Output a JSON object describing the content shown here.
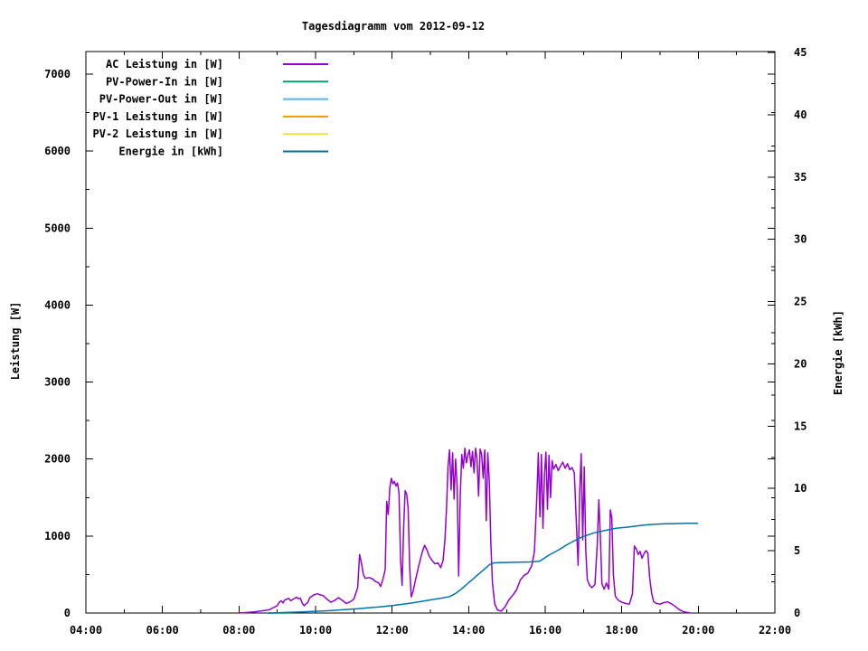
{
  "title": "Tagesdiagramm vom 2012-09-12",
  "axes": {
    "y1_label": "Leistung [W]",
    "y2_label": "Energie [kWh]"
  },
  "legend": [
    {
      "label": "AC Leistung in [W]",
      "color": "#9400d3"
    },
    {
      "label": "PV-Power-In in [W]",
      "color": "#009e73"
    },
    {
      "label": "PV-Power-Out in [W]",
      "color": "#56b4e9"
    },
    {
      "label": "PV-1 Leistung in [W]",
      "color": "#e69f00"
    },
    {
      "label": "PV-2 Leistung in [W]",
      "color": "#f0e442"
    },
    {
      "label": "Energie in [kWh]",
      "color": "#0072b2"
    }
  ],
  "chart_data": {
    "type": "line",
    "title": "Tagesdiagramm vom 2012-09-12",
    "grid": false,
    "legend_position": "top-left-inside",
    "x_axis": {
      "unit": "time",
      "range_hours": [
        4,
        22
      ],
      "ticks": [
        [
          4,
          "04:00"
        ],
        [
          5,
          ""
        ],
        [
          6,
          "06:00"
        ],
        [
          7,
          ""
        ],
        [
          8,
          "08:00"
        ],
        [
          9,
          ""
        ],
        [
          10,
          "10:00"
        ],
        [
          11,
          ""
        ],
        [
          12,
          "12:00"
        ],
        [
          13,
          ""
        ],
        [
          14,
          "14:00"
        ],
        [
          15,
          ""
        ],
        [
          16,
          "16:00"
        ],
        [
          17,
          ""
        ],
        [
          18,
          "18:00"
        ],
        [
          19,
          ""
        ],
        [
          20,
          "20:00"
        ],
        [
          21,
          ""
        ],
        [
          22,
          "22:00"
        ]
      ]
    },
    "y1_axis": {
      "label": "Leistung [W]",
      "range": [
        0,
        7300
      ],
      "ticks": [
        [
          0,
          "0"
        ],
        [
          500,
          ""
        ],
        [
          1000,
          "1000"
        ],
        [
          1500,
          ""
        ],
        [
          2000,
          "2000"
        ],
        [
          2500,
          ""
        ],
        [
          3000,
          "3000"
        ],
        [
          3500,
          ""
        ],
        [
          4000,
          "4000"
        ],
        [
          4500,
          ""
        ],
        [
          5000,
          "5000"
        ],
        [
          5500,
          ""
        ],
        [
          6000,
          "6000"
        ],
        [
          6500,
          ""
        ],
        [
          7000,
          "7000"
        ]
      ]
    },
    "y2_axis": {
      "label": "Energie [kWh]",
      "range": [
        0,
        45
      ],
      "ticks": [
        [
          0,
          "0"
        ],
        [
          2.5,
          ""
        ],
        [
          5,
          "5"
        ],
        [
          7.5,
          ""
        ],
        [
          10,
          "10"
        ],
        [
          12.5,
          ""
        ],
        [
          15,
          "15"
        ],
        [
          17.5,
          ""
        ],
        [
          20,
          "20"
        ],
        [
          22.5,
          ""
        ],
        [
          25,
          "25"
        ],
        [
          27.5,
          ""
        ],
        [
          30,
          "30"
        ],
        [
          32.5,
          ""
        ],
        [
          35,
          "35"
        ],
        [
          37.5,
          ""
        ],
        [
          40,
          "40"
        ],
        [
          42.5,
          ""
        ],
        [
          45,
          "45"
        ]
      ]
    },
    "series": [
      {
        "name": "AC Leistung in [W]",
        "axis": "y1",
        "color": "#9400d3",
        "width": 1.5,
        "points": [
          [
            7.97,
            0
          ],
          [
            8.1,
            3
          ],
          [
            8.25,
            8
          ],
          [
            8.4,
            15
          ],
          [
            8.55,
            25
          ],
          [
            8.7,
            35
          ],
          [
            8.8,
            45
          ],
          [
            8.9,
            70
          ],
          [
            9.0,
            95
          ],
          [
            9.05,
            140
          ],
          [
            9.1,
            160
          ],
          [
            9.15,
            130
          ],
          [
            9.2,
            170
          ],
          [
            9.3,
            190
          ],
          [
            9.35,
            160
          ],
          [
            9.4,
            175
          ],
          [
            9.5,
            205
          ],
          [
            9.55,
            185
          ],
          [
            9.6,
            195
          ],
          [
            9.65,
            130
          ],
          [
            9.7,
            95
          ],
          [
            9.8,
            140
          ],
          [
            9.85,
            200
          ],
          [
            9.95,
            235
          ],
          [
            10.05,
            250
          ],
          [
            10.1,
            240
          ],
          [
            10.2,
            225
          ],
          [
            10.3,
            180
          ],
          [
            10.4,
            140
          ],
          [
            10.5,
            165
          ],
          [
            10.6,
            200
          ],
          [
            10.7,
            165
          ],
          [
            10.8,
            125
          ],
          [
            10.9,
            145
          ],
          [
            11.0,
            180
          ],
          [
            11.1,
            330
          ],
          [
            11.15,
            760
          ],
          [
            11.2,
            650
          ],
          [
            11.25,
            500
          ],
          [
            11.3,
            450
          ],
          [
            11.4,
            460
          ],
          [
            11.5,
            440
          ],
          [
            11.55,
            415
          ],
          [
            11.65,
            390
          ],
          [
            11.7,
            345
          ],
          [
            11.75,
            420
          ],
          [
            11.82,
            560
          ],
          [
            11.86,
            1450
          ],
          [
            11.9,
            1280
          ],
          [
            11.94,
            1620
          ],
          [
            11.98,
            1750
          ],
          [
            12.02,
            1680
          ],
          [
            12.06,
            1710
          ],
          [
            12.1,
            1650
          ],
          [
            12.14,
            1690
          ],
          [
            12.18,
            1560
          ],
          [
            12.22,
            700
          ],
          [
            12.26,
            360
          ],
          [
            12.3,
            1100
          ],
          [
            12.34,
            1590
          ],
          [
            12.38,
            1540
          ],
          [
            12.42,
            1360
          ],
          [
            12.46,
            600
          ],
          [
            12.5,
            210
          ],
          [
            12.55,
            290
          ],
          [
            12.62,
            450
          ],
          [
            12.7,
            620
          ],
          [
            12.78,
            780
          ],
          [
            12.85,
            880
          ],
          [
            12.9,
            830
          ],
          [
            12.97,
            740
          ],
          [
            13.05,
            680
          ],
          [
            13.12,
            640
          ],
          [
            13.2,
            650
          ],
          [
            13.27,
            590
          ],
          [
            13.33,
            680
          ],
          [
            13.38,
            950
          ],
          [
            13.42,
            1350
          ],
          [
            13.46,
            1900
          ],
          [
            13.5,
            2120
          ],
          [
            13.54,
            1600
          ],
          [
            13.58,
            2080
          ],
          [
            13.62,
            1480
          ],
          [
            13.66,
            2000
          ],
          [
            13.7,
            1650
          ],
          [
            13.74,
            480
          ],
          [
            13.78,
            1500
          ],
          [
            13.82,
            2060
          ],
          [
            13.86,
            1880
          ],
          [
            13.9,
            2140
          ],
          [
            13.94,
            1950
          ],
          [
            13.98,
            2050
          ],
          [
            14.02,
            2120
          ],
          [
            14.06,
            1900
          ],
          [
            14.1,
            2100
          ],
          [
            14.14,
            1820
          ],
          [
            14.18,
            2140
          ],
          [
            14.22,
            2000
          ],
          [
            14.26,
            1520
          ],
          [
            14.3,
            2130
          ],
          [
            14.34,
            2060
          ],
          [
            14.38,
            1750
          ],
          [
            14.42,
            2120
          ],
          [
            14.46,
            1200
          ],
          [
            14.5,
            2080
          ],
          [
            14.54,
            1700
          ],
          [
            14.58,
            900
          ],
          [
            14.62,
            400
          ],
          [
            14.68,
            120
          ],
          [
            14.75,
            40
          ],
          [
            14.85,
            25
          ],
          [
            14.95,
            80
          ],
          [
            15.05,
            170
          ],
          [
            15.15,
            230
          ],
          [
            15.25,
            300
          ],
          [
            15.35,
            430
          ],
          [
            15.45,
            490
          ],
          [
            15.55,
            520
          ],
          [
            15.65,
            620
          ],
          [
            15.72,
            800
          ],
          [
            15.78,
            1500
          ],
          [
            15.82,
            2080
          ],
          [
            15.86,
            1250
          ],
          [
            15.9,
            2060
          ],
          [
            15.94,
            1100
          ],
          [
            15.98,
            1800
          ],
          [
            16.02,
            2090
          ],
          [
            16.06,
            1350
          ],
          [
            16.1,
            2050
          ],
          [
            16.14,
            1500
          ],
          [
            16.18,
            1980
          ],
          [
            16.22,
            1870
          ],
          [
            16.28,
            1930
          ],
          [
            16.34,
            1850
          ],
          [
            16.4,
            1910
          ],
          [
            16.46,
            1960
          ],
          [
            16.52,
            1880
          ],
          [
            16.58,
            1940
          ],
          [
            16.64,
            1860
          ],
          [
            16.7,
            1890
          ],
          [
            16.76,
            1820
          ],
          [
            16.82,
            1100
          ],
          [
            16.86,
            620
          ],
          [
            16.9,
            1550
          ],
          [
            16.94,
            2070
          ],
          [
            16.98,
            950
          ],
          [
            17.02,
            1900
          ],
          [
            17.06,
            800
          ],
          [
            17.1,
            430
          ],
          [
            17.16,
            360
          ],
          [
            17.22,
            330
          ],
          [
            17.3,
            370
          ],
          [
            17.36,
            900
          ],
          [
            17.4,
            1470
          ],
          [
            17.44,
            1000
          ],
          [
            17.48,
            380
          ],
          [
            17.54,
            310
          ],
          [
            17.6,
            390
          ],
          [
            17.66,
            310
          ],
          [
            17.7,
            1340
          ],
          [
            17.74,
            1230
          ],
          [
            17.78,
            500
          ],
          [
            17.83,
            220
          ],
          [
            17.9,
            170
          ],
          [
            18.0,
            140
          ],
          [
            18.1,
            125
          ],
          [
            18.2,
            115
          ],
          [
            18.28,
            250
          ],
          [
            18.33,
            870
          ],
          [
            18.38,
            830
          ],
          [
            18.43,
            760
          ],
          [
            18.48,
            800
          ],
          [
            18.53,
            710
          ],
          [
            18.58,
            770
          ],
          [
            18.63,
            810
          ],
          [
            18.68,
            780
          ],
          [
            18.73,
            450
          ],
          [
            18.78,
            260
          ],
          [
            18.83,
            150
          ],
          [
            18.9,
            125
          ],
          [
            19.0,
            115
          ],
          [
            19.1,
            135
          ],
          [
            19.2,
            145
          ],
          [
            19.3,
            120
          ],
          [
            19.4,
            85
          ],
          [
            19.5,
            45
          ],
          [
            19.6,
            20
          ],
          [
            19.7,
            8
          ],
          [
            19.78,
            2
          ]
        ]
      },
      {
        "name": "PV-Power-In in [W]",
        "axis": "y1",
        "color": "#009e73",
        "width": 1.5,
        "points": [
          [
            8.75,
            0
          ],
          [
            9.35,
            0
          ]
        ]
      },
      {
        "name": "PV-Power-Out in [W]",
        "axis": "y1",
        "color": "#56b4e9",
        "width": 1.5,
        "points": []
      },
      {
        "name": "PV-1 Leistung in [W]",
        "axis": "y1",
        "color": "#e69f00",
        "width": 1.5,
        "points": []
      },
      {
        "name": "PV-2 Leistung in [W]",
        "axis": "y1",
        "color": "#f0e442",
        "width": 1.5,
        "points": []
      },
      {
        "name": "Energie in [kWh]",
        "axis": "y2",
        "color": "#0072b2",
        "width": 1.5,
        "points": [
          [
            8.75,
            0
          ],
          [
            9.0,
            0.02
          ],
          [
            9.3,
            0.05
          ],
          [
            9.6,
            0.08
          ],
          [
            9.9,
            0.12
          ],
          [
            10.2,
            0.17
          ],
          [
            10.5,
            0.22
          ],
          [
            10.8,
            0.28
          ],
          [
            11.1,
            0.35
          ],
          [
            11.4,
            0.43
          ],
          [
            11.7,
            0.5
          ],
          [
            11.95,
            0.58
          ],
          [
            12.1,
            0.63
          ],
          [
            12.3,
            0.72
          ],
          [
            12.5,
            0.8
          ],
          [
            12.7,
            0.9
          ],
          [
            12.9,
            1.0
          ],
          [
            13.1,
            1.1
          ],
          [
            13.3,
            1.2
          ],
          [
            13.5,
            1.32
          ],
          [
            13.65,
            1.55
          ],
          [
            13.8,
            1.9
          ],
          [
            13.95,
            2.3
          ],
          [
            14.1,
            2.7
          ],
          [
            14.25,
            3.1
          ],
          [
            14.4,
            3.5
          ],
          [
            14.55,
            3.9
          ],
          [
            14.65,
            4.02
          ],
          [
            14.8,
            4.05
          ],
          [
            15.2,
            4.07
          ],
          [
            15.6,
            4.1
          ],
          [
            15.85,
            4.15
          ],
          [
            15.95,
            4.35
          ],
          [
            16.1,
            4.65
          ],
          [
            16.25,
            4.9
          ],
          [
            16.4,
            5.15
          ],
          [
            16.55,
            5.45
          ],
          [
            16.7,
            5.7
          ],
          [
            16.85,
            5.95
          ],
          [
            17.0,
            6.15
          ],
          [
            17.15,
            6.3
          ],
          [
            17.3,
            6.45
          ],
          [
            17.45,
            6.55
          ],
          [
            17.6,
            6.65
          ],
          [
            17.75,
            6.75
          ],
          [
            17.9,
            6.82
          ],
          [
            18.1,
            6.88
          ],
          [
            18.3,
            6.95
          ],
          [
            18.5,
            7.03
          ],
          [
            18.7,
            7.1
          ],
          [
            18.9,
            7.13
          ],
          [
            19.1,
            7.16
          ],
          [
            19.4,
            7.18
          ],
          [
            19.7,
            7.2
          ],
          [
            19.98,
            7.2
          ]
        ]
      }
    ]
  }
}
